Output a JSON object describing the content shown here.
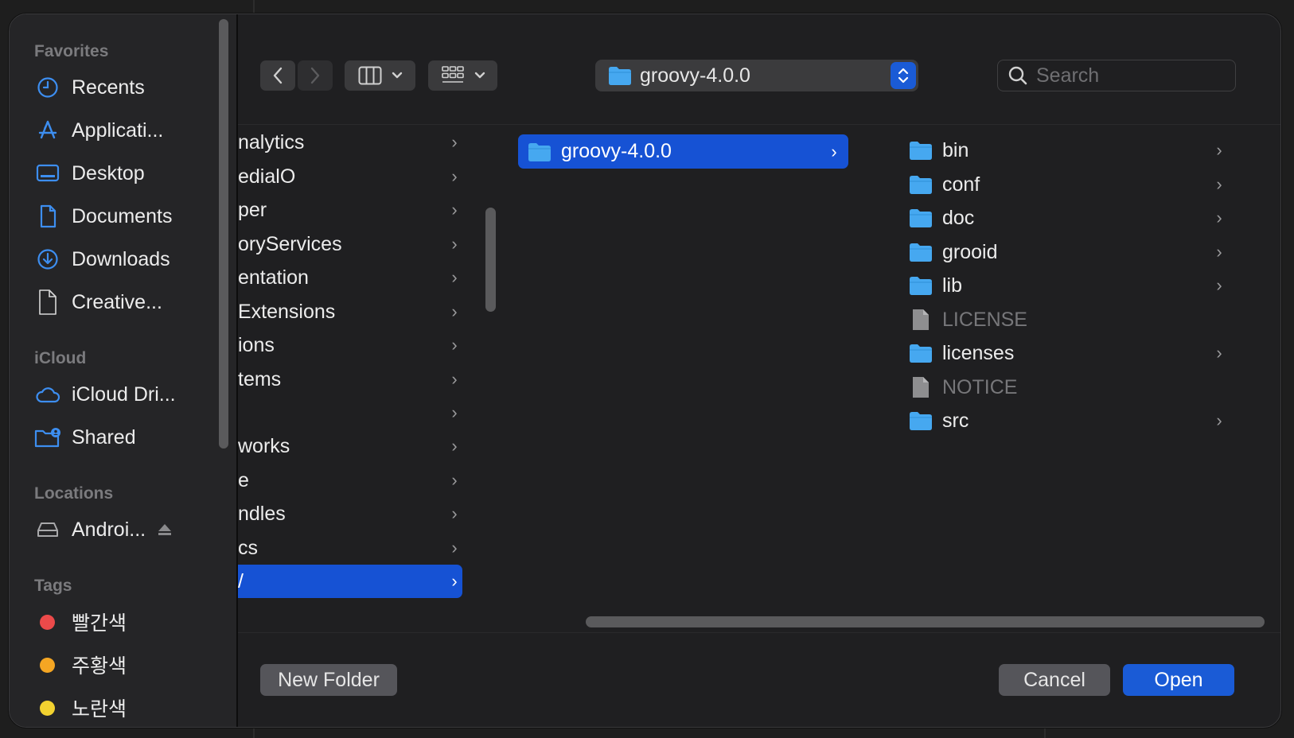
{
  "sidebar": {
    "favorites_title": "Favorites",
    "favorites": [
      {
        "label": "Recents",
        "icon": "clock-icon"
      },
      {
        "label": "Applicati...",
        "icon": "applications-icon"
      },
      {
        "label": "Desktop",
        "icon": "desktop-icon"
      },
      {
        "label": "Documents",
        "icon": "document-icon"
      },
      {
        "label": "Downloads",
        "icon": "download-icon"
      },
      {
        "label": "Creative...",
        "icon": "file-icon"
      }
    ],
    "icloud_title": "iCloud",
    "icloud": [
      {
        "label": "iCloud Dri...",
        "icon": "cloud-icon"
      },
      {
        "label": "Shared",
        "icon": "shared-folder-icon"
      }
    ],
    "locations_title": "Locations",
    "locations": [
      {
        "label": "Androi...",
        "icon": "drive-icon"
      }
    ],
    "tags_title": "Tags",
    "tags": [
      {
        "label": "빨간색",
        "color": "#ec4a4a"
      },
      {
        "label": "주황색",
        "color": "#f5a623"
      },
      {
        "label": "노란색",
        "color": "#f2d230"
      }
    ]
  },
  "toolbar": {
    "path": "groovy-4.0.0",
    "search_placeholder": "Search"
  },
  "column1": {
    "items": [
      "nalytics",
      "edialO",
      "per",
      "oryServices",
      "entation",
      "Extensions",
      "ions",
      "tems",
      "",
      "works",
      "e",
      "ndles",
      "cs",
      "/"
    ],
    "selected_index": 13
  },
  "column2": {
    "items": [
      "groovy-4.0.0"
    ]
  },
  "column3": {
    "items": [
      {
        "name": "bin",
        "type": "folder"
      },
      {
        "name": "conf",
        "type": "folder"
      },
      {
        "name": "doc",
        "type": "folder"
      },
      {
        "name": "grooid",
        "type": "folder"
      },
      {
        "name": "lib",
        "type": "folder"
      },
      {
        "name": "LICENSE",
        "type": "file"
      },
      {
        "name": "licenses",
        "type": "folder"
      },
      {
        "name": "NOTICE",
        "type": "file"
      },
      {
        "name": "src",
        "type": "folder"
      }
    ]
  },
  "buttons": {
    "new_folder": "New Folder",
    "cancel": "Cancel",
    "open": "Open"
  },
  "colors": {
    "accent": "#1a5bd6",
    "selection": "#1652d4",
    "folder": "#46a8f0"
  }
}
